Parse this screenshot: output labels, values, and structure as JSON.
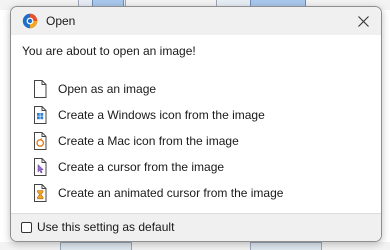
{
  "dialog": {
    "title": "Open",
    "message": "You are about to open an image!"
  },
  "options": [
    {
      "label": "Open as an image",
      "icon": "document-icon"
    },
    {
      "label": "Create a Windows icon from the image",
      "icon": "windows-icon-file-icon"
    },
    {
      "label": "Create a Mac icon from the image",
      "icon": "mac-icon-file-icon"
    },
    {
      "label": "Create a cursor from the image",
      "icon": "cursor-file-icon"
    },
    {
      "label": "Create an animated cursor from the image",
      "icon": "animated-cursor-file-icon"
    }
  ],
  "footer": {
    "checkbox_label": "Use this setting as default",
    "checked": false
  },
  "colors": {
    "titlebar": "#f0f0f0",
    "footer": "#f0f0f0",
    "accent_blue": "#2f7fd6",
    "accent_orange": "#e07a1f"
  }
}
